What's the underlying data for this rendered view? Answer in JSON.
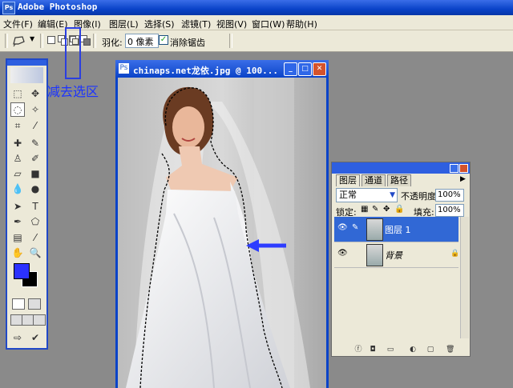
{
  "app": {
    "title": "Adobe Photoshop",
    "icon": "photoshop-icon"
  },
  "menu": [
    "文件(F)",
    "编辑(E)",
    "图像(I)",
    "图层(L)",
    "选择(S)",
    "滤镜(T)",
    "视图(V)",
    "窗口(W)",
    "帮助(H)"
  ],
  "options": {
    "feather_label": "羽化:",
    "feather_value": "0 像素",
    "antialias_label": "消除锯齿",
    "antialias_checked": true,
    "selection_mode": "subtract"
  },
  "annotation": {
    "text": "减去选区",
    "color": "#1c34ff"
  },
  "document": {
    "title": "chinaps.net龙依.jpg @ 100..."
  },
  "colors": {
    "foreground": "#2b31ff",
    "background": "#000000",
    "titlebar": "#0a43c8"
  },
  "layers_panel": {
    "tabs": [
      "图层",
      "通道",
      "路径"
    ],
    "blend_mode": "正常",
    "opacity_label": "不透明度:",
    "opacity_value": "100%",
    "lock_label": "锁定:",
    "fill_label": "填充:",
    "fill_value": "100%",
    "layers": [
      {
        "name": "图层 1",
        "selected": true
      },
      {
        "name": "背景",
        "selected": false,
        "locked": true
      }
    ]
  }
}
